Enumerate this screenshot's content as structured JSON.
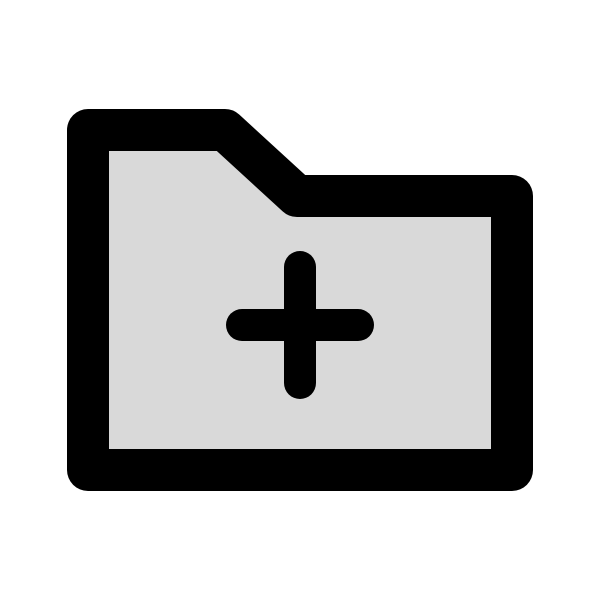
{
  "icon": {
    "name": "folder-add-icon",
    "outline_color": "#000000",
    "fill_color": "#d9d9d9",
    "background_color": "#ffffff"
  }
}
